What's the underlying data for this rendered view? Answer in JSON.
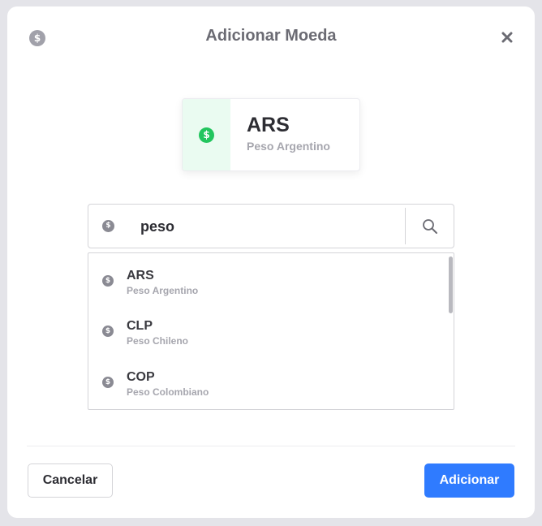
{
  "modal": {
    "title": "Adicionar Moeda",
    "header_icon": "dollar-coin-icon",
    "close_icon": "close-icon"
  },
  "selected": {
    "code": "ARS",
    "name": "Peso Argentino",
    "icon": "dollar-coin-icon",
    "accent": "#22c55e"
  },
  "search": {
    "value": "peso",
    "icon": "search-icon"
  },
  "results": [
    {
      "code": "ARS",
      "name": "Peso Argentino"
    },
    {
      "code": "CLP",
      "name": "Peso Chileno"
    },
    {
      "code": "COP",
      "name": "Peso Colombiano"
    }
  ],
  "footer": {
    "cancel_label": "Cancelar",
    "add_label": "Adicionar",
    "add_color": "#2f7bff"
  },
  "symbols": {
    "dollar": "$"
  }
}
